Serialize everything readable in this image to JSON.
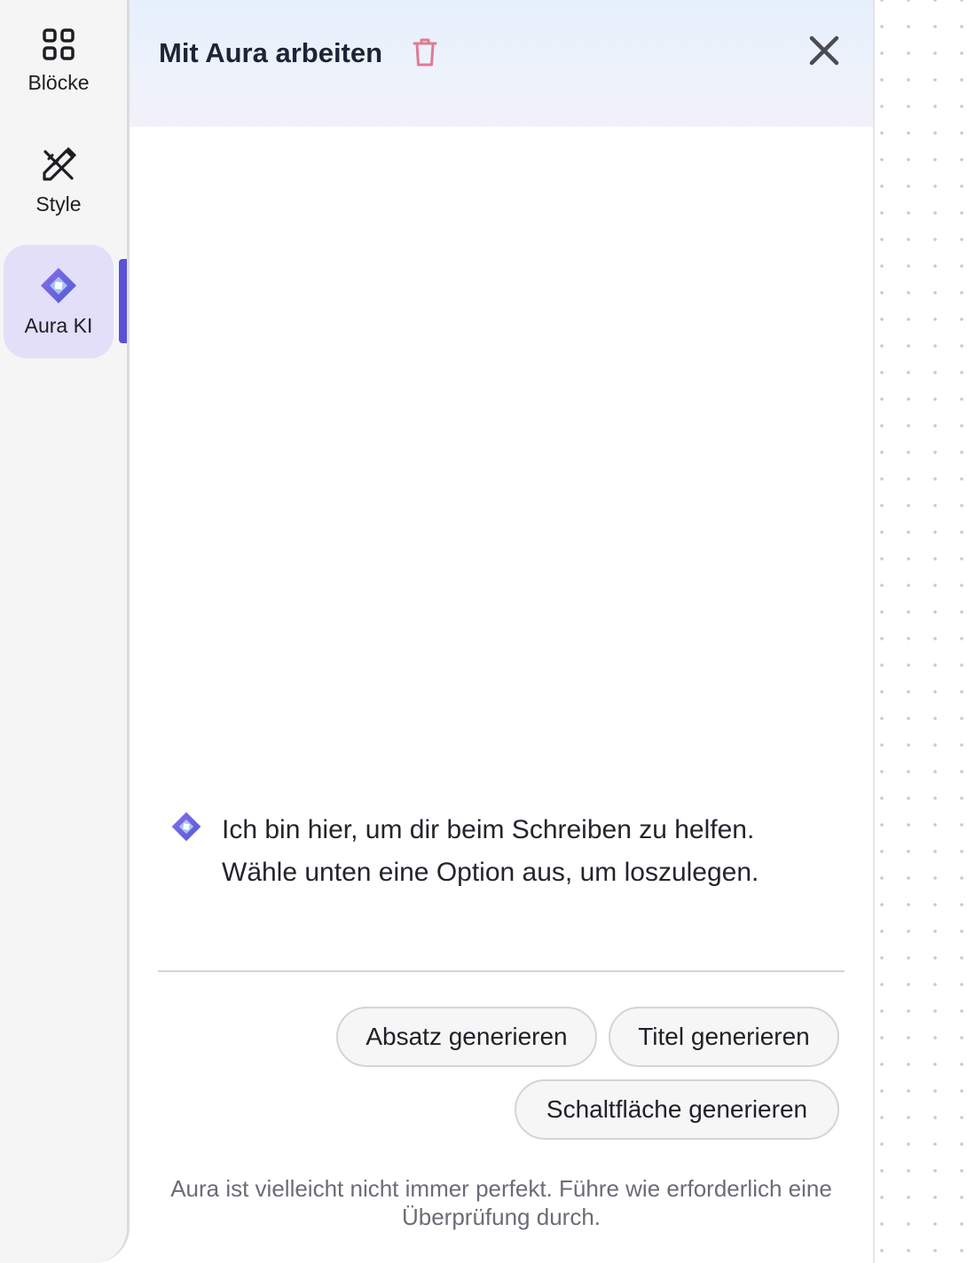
{
  "sidebar": {
    "items": [
      {
        "label": "Blöcke",
        "icon": "grid-icon",
        "active": false
      },
      {
        "label": "Style",
        "icon": "pen-ruler-icon",
        "active": false
      },
      {
        "label": "Aura KI",
        "icon": "aura-diamond-icon",
        "active": true
      }
    ]
  },
  "panel": {
    "title": "Mit Aura arbeiten",
    "trash_icon": "trash-icon",
    "close_icon": "close-icon",
    "message": {
      "line1": "Ich bin hier, um dir beim Schreiben zu helfen.",
      "line2": "Wähle unten eine Option aus, um loszulegen."
    },
    "suggestions": [
      "Absatz generieren",
      "Titel generieren",
      "Schaltfläche generieren"
    ],
    "disclaimer": {
      "line1": "Aura ist vielleicht nicht immer perfekt. Führe wie erforderlich eine",
      "line2": "Überprüfung durch."
    }
  },
  "colors": {
    "accent": "#5b51d8",
    "active_item_bg": "#e3dff8",
    "trash": "#e07a93",
    "header_gradient_top": "#e6f0fc"
  }
}
